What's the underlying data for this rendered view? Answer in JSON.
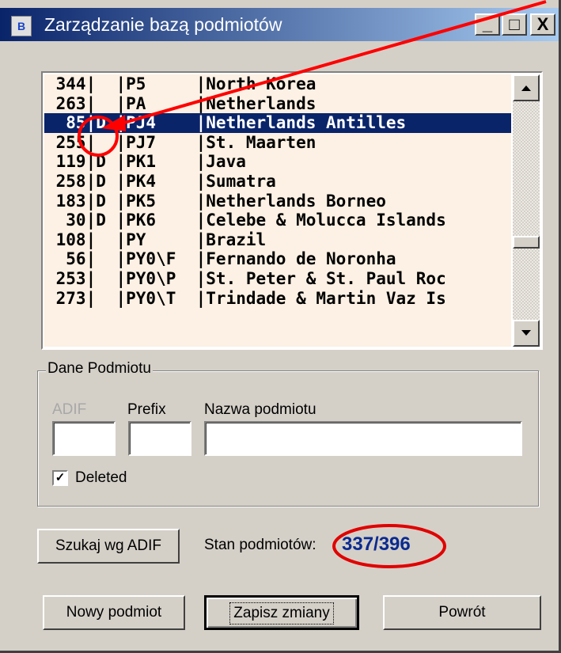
{
  "window": {
    "title": "Zarządzanie bazą podmiotów",
    "icon_label": "B"
  },
  "titlebar_buttons": [
    "_",
    "□",
    "X"
  ],
  "list": {
    "selected_index": 2,
    "rows": [
      " 344|  |P5     |North Korea",
      " 263|  |PA     |Netherlands",
      "  85|D |PJ4    |Netherlands Antilles",
      " 255|  |PJ7    |St. Maarten",
      " 119|D |PK1    |Java",
      " 258|D |PK4    |Sumatra",
      " 183|D |PK5    |Netherlands Borneo",
      "  30|D |PK6    |Celebe & Molucca Islands",
      " 108|  |PY     |Brazil",
      "  56|  |PY0\\F  |Fernando de Noronha",
      " 253|  |PY0\\P  |St. Peter & St. Paul Roc",
      " 273|  |PY0\\T  |Trindade & Martin Vaz Is"
    ]
  },
  "group": {
    "legend": "Dane Podmiotu",
    "adif_label": "ADIF",
    "prefix_label": "Prefix",
    "name_label": "Nazwa podmiotu",
    "adif_value": "",
    "prefix_value": "",
    "name_value": "",
    "deleted_label": "Deleted",
    "deleted_checked": true
  },
  "search_button": "Szukaj wg ADIF",
  "status": {
    "label": "Stan podmiotów:",
    "count": "337/396"
  },
  "buttons": {
    "new": "Nowy podmiot",
    "save": "Zapisz zmiany",
    "back": "Powrót"
  },
  "colors": {
    "titlebar": "#0a246a",
    "selection": "#0a246a",
    "list_bg": "#fcf1e4",
    "annotation": "#ff0000",
    "count": "#0a2a90"
  }
}
